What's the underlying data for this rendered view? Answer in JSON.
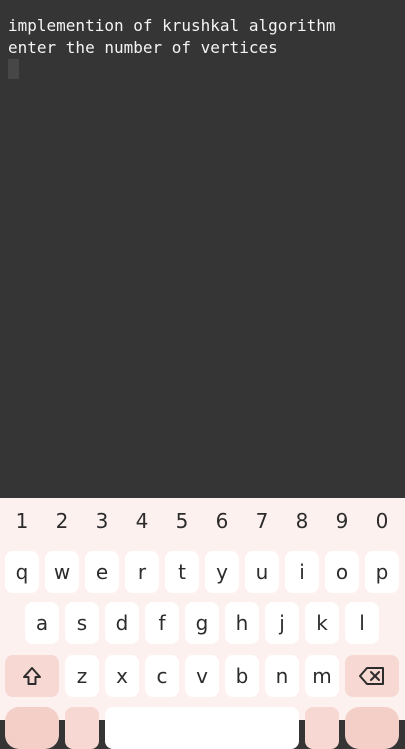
{
  "terminal": {
    "lines": [
      "implemention of krushkal algorithm",
      "enter the number of vertices"
    ]
  },
  "keyboard": {
    "number_row": [
      "1",
      "2",
      "3",
      "4",
      "5",
      "6",
      "7",
      "8",
      "9",
      "0"
    ],
    "row1": [
      "q",
      "w",
      "e",
      "r",
      "t",
      "y",
      "u",
      "i",
      "o",
      "p"
    ],
    "row2": [
      "a",
      "s",
      "d",
      "f",
      "g",
      "h",
      "j",
      "k",
      "l"
    ],
    "row3": [
      "z",
      "x",
      "c",
      "v",
      "b",
      "n",
      "m"
    ],
    "shift_icon": "shift-arrow-icon",
    "backspace_icon": "backspace-icon",
    "colors": {
      "keyboard_bg": "#fcf1ef",
      "key_bg": "#ffffff",
      "modifier_bg": "#f8d8d3",
      "terminal_bg": "#353535",
      "terminal_text": "#f4f4f4"
    }
  }
}
